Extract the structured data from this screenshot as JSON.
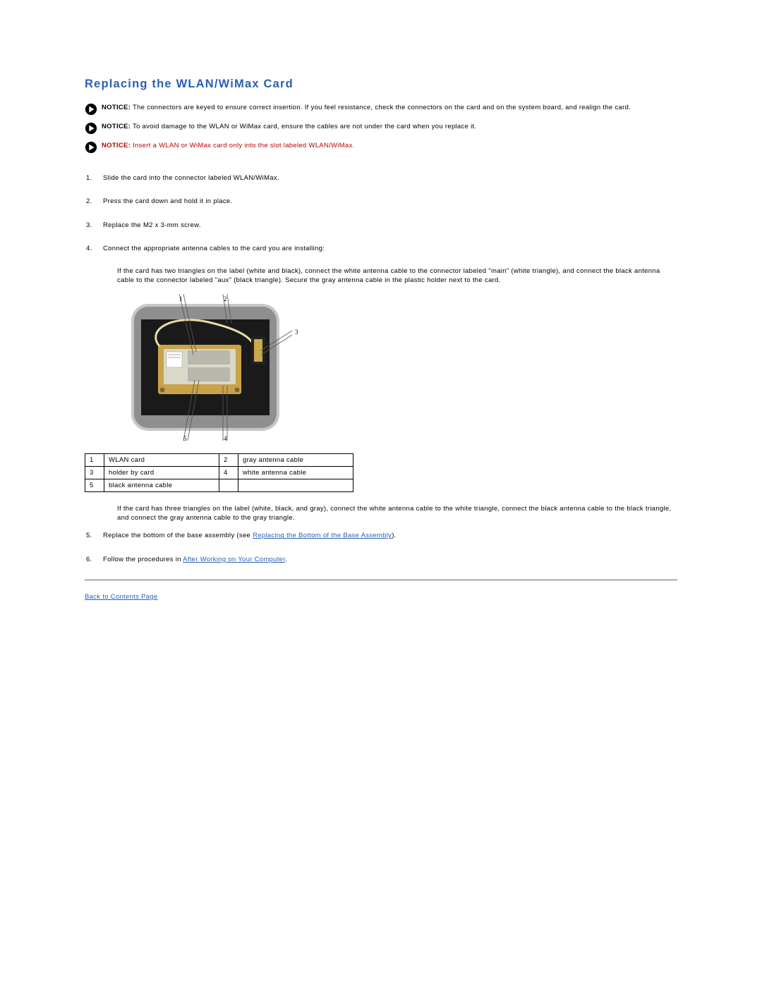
{
  "title": "Replacing the WLAN/WiMax Card",
  "notices": [
    {
      "label": "NOTICE:",
      "text": "The connectors are keyed to ensure correct insertion. If you feel resistance, check the connectors on the card and on the system board, and realign the card.",
      "red": false
    },
    {
      "label": "NOTICE:",
      "text": "To avoid damage to the WLAN or WiMax card, ensure the cables are not under the card when you replace it.",
      "red": false
    },
    {
      "label": "NOTICE:",
      "text": "Insert a WLAN or WiMax card only into the slot labeled WLAN/WiMax.",
      "red": true
    }
  ],
  "steps": {
    "s1": "Slide the card into the connector labeled WLAN/WiMax.",
    "s2": "Press the card down and hold it in place.",
    "s3": "Replace the M2 x 3-mm screw.",
    "s4": "Connect the appropriate antenna cables to the card you are installing:",
    "s4_para1": "If the card has two triangles on the label (white and black), connect the white antenna cable to the connector labeled \"main\" (white triangle), and connect the black antenna cable to the connector labeled \"aux\" (black triangle). Secure the gray antenna cable in the plastic holder next to the card.",
    "s4_para2": "If the card has three triangles on the label (white, black, and gray), connect the white antenna cable to the white triangle, connect the black antenna cable to the black triangle, and connect the gray antenna cable to the gray triangle.",
    "s5_pre": "Replace the bottom of the base assembly (see ",
    "s5_link": "Replacing the Bottom of the Base Assembly",
    "s5_post": ").",
    "s6_pre": "Follow the procedures in ",
    "s6_link": "After Working on Your Computer",
    "s6_post": "."
  },
  "diagram_labels": {
    "l1": "1",
    "l2": "2",
    "l3": "3",
    "l4": "4",
    "l5": "5"
  },
  "callouts": [
    {
      "n": "1",
      "t": "WLAN card"
    },
    {
      "n": "2",
      "t": "gray antenna cable"
    },
    {
      "n": "3",
      "t": "holder by card"
    },
    {
      "n": "4",
      "t": "white antenna cable"
    },
    {
      "n": "5",
      "t": "black antenna cable"
    }
  ],
  "back_link": "Back to Contents Page"
}
